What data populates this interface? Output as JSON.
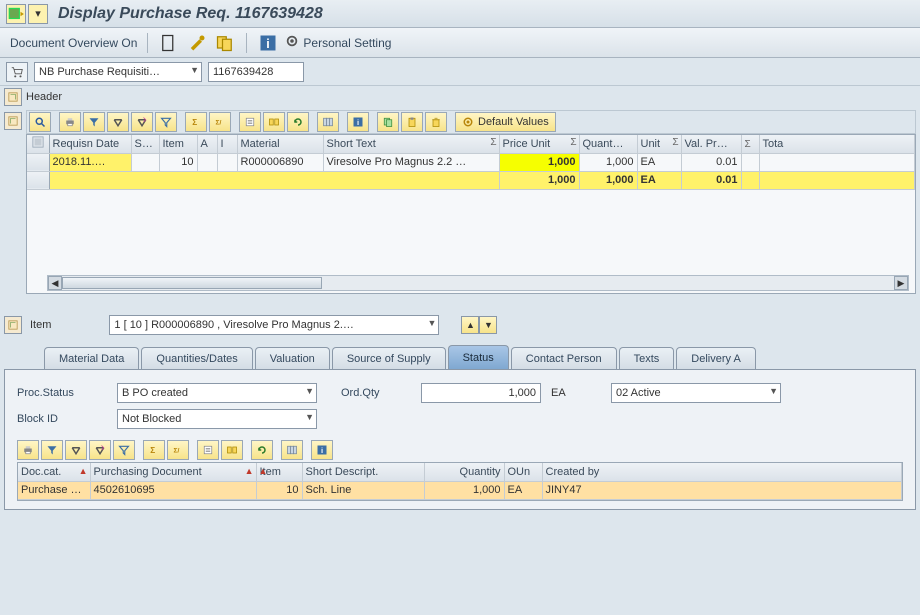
{
  "title": "Display Purchase Req. 1167639428",
  "toolbar": {
    "doc_overview": "Document Overview On",
    "personal_setting": "Personal Setting"
  },
  "selection": {
    "doc_type": "NB Purchase Requisiti…",
    "doc_number": "1167639428",
    "header_label": "Header"
  },
  "grid_toolbar": {
    "default_values": "Default Values"
  },
  "columns": {
    "requisn_date": "Requisn Date",
    "st": "St…",
    "item": "Item",
    "a": "A",
    "i": "I",
    "material": "Material",
    "short_text": "Short Text",
    "price_unit": "Price Unit",
    "quant": "Quant…",
    "unit": "Unit",
    "val_pr": "Val. Pr…",
    "total": "Tota"
  },
  "row": {
    "requisn_date": "2018.11.…",
    "st": "",
    "item": "10",
    "a": "",
    "i": "",
    "material": "R000006890",
    "short_text": "Viresolve Pro Magnus 2.2 …",
    "price_unit": "1,000",
    "quant": "1,000",
    "unit": "EA",
    "val_pr": "0.01",
    "total": ""
  },
  "totals": {
    "price_unit": "1,000",
    "quant": "1,000",
    "unit": "EA",
    "val_pr": "0.01"
  },
  "item_detail": {
    "label": "Item",
    "selector": "1 [ 10 ] R000006890 , Viresolve Pro Magnus 2.…"
  },
  "tabs": {
    "material_data": "Material Data",
    "quantities_dates": "Quantities/Dates",
    "valuation": "Valuation",
    "source_of_supply": "Source of Supply",
    "status": "Status",
    "contact_person": "Contact Person",
    "texts": "Texts",
    "delivery": "Delivery A"
  },
  "status_panel": {
    "proc_status_label": "Proc.Status",
    "proc_status_value": "B PO created",
    "ord_qty_label": "Ord.Qty",
    "ord_qty_value": "1,000",
    "ord_qty_unit": "EA",
    "active_value": "02 Active",
    "block_id_label": "Block ID",
    "block_id_value": "Not Blocked"
  },
  "lower_columns": {
    "doc_cat": "Doc.cat.",
    "purch_doc": "Purchasing Document",
    "item": "Item",
    "short_desc": "Short Descript.",
    "quantity": "Quantity",
    "oun": "OUn",
    "created_by": "Created by"
  },
  "lower_row": {
    "doc_cat": "Purchase …",
    "purch_doc": "4502610695",
    "item": "10",
    "short_desc": "Sch. Line",
    "quantity": "1,000",
    "oun": "EA",
    "created_by": "JINY47"
  }
}
